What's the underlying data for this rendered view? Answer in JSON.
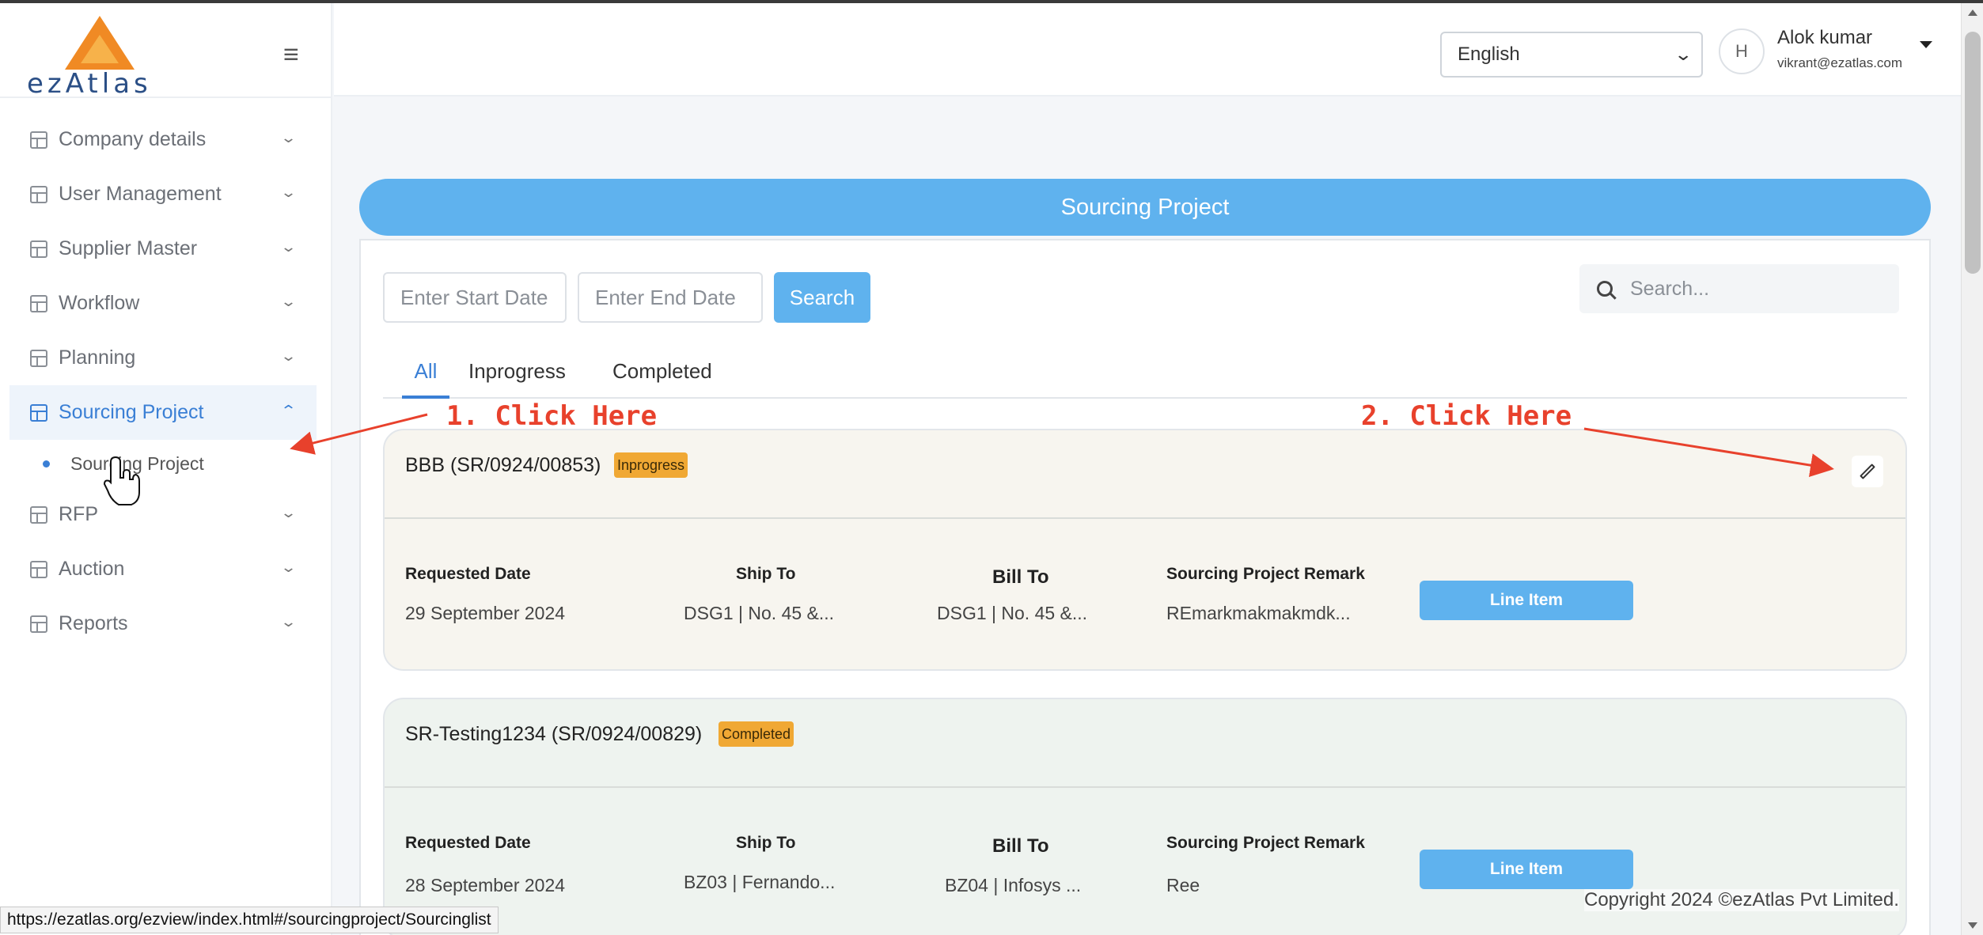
{
  "brand": {
    "name": "ezAtlas",
    "logo_colors": [
      "#f08a24",
      "#f7b24a"
    ]
  },
  "header": {
    "language": "English",
    "avatar_alt": "H",
    "user_name": "Alok kumar",
    "user_email": "vikrant@ezatlas.com"
  },
  "sidebar": {
    "items": [
      {
        "label": "Company details",
        "icon": "book-icon"
      },
      {
        "label": "User Management",
        "icon": "table-icon"
      },
      {
        "label": "Supplier Master",
        "icon": "table-icon"
      },
      {
        "label": "Workflow",
        "icon": "table-icon"
      },
      {
        "label": "Planning",
        "icon": "table-icon"
      },
      {
        "label": "Sourcing Project",
        "icon": "table-icon",
        "active": true
      },
      {
        "label": "RFP",
        "icon": "table-icon"
      },
      {
        "label": "Auction",
        "icon": "table-icon"
      },
      {
        "label": "Reports",
        "icon": "table-icon"
      }
    ],
    "subitem": "Sourcing Project"
  },
  "page": {
    "banner": "Sourcing Project",
    "start_date_placeholder": "Enter Start Date",
    "end_date_placeholder": "Enter End Date",
    "search_button": "Search",
    "search_placeholder": "Search...",
    "tabs": [
      "All",
      "Inprogress",
      "Completed"
    ],
    "active_tab": "All"
  },
  "labels": {
    "requested_date": "Requested Date",
    "ship_to": "Ship To",
    "bill_to": "Bill To",
    "remark": "Sourcing Project Remark",
    "line_item": "Line Item"
  },
  "projects": [
    {
      "title": "BBB (SR/0924/00853)",
      "status": "Inprogress",
      "requested_date": "29 September 2024",
      "ship_to": "DSG1 | No. 45 &...",
      "bill_to": "DSG1 | No. 45 &...",
      "remark": "REmarkmakmakmdk..."
    },
    {
      "title": "SR-Testing1234 (SR/0924/00829)",
      "status": "Completed",
      "requested_date": "28 September 2024",
      "ship_to": "BZ03 | Fernando...",
      "bill_to": "BZ04 | Infosys ...",
      "remark": "Ree"
    }
  ],
  "annotations": {
    "step1": "1. Click Here",
    "step2": "2. Click Here",
    "color": "#e8412c"
  },
  "footer": {
    "copyright": "Copyright 2024 ©ezAtlas Pvt Limited."
  },
  "status_url": "https://ezatlas.org/ezview/index.html#/sourcingproject/Sourcinglist",
  "colors": {
    "accent": "#5fb2ee",
    "active_nav": "#3a7fd5",
    "badge": "#f0a834"
  }
}
